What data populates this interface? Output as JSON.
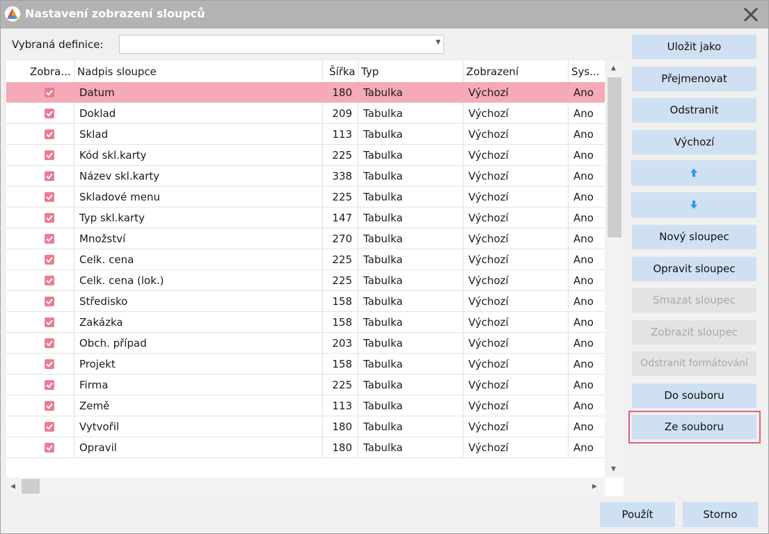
{
  "window": {
    "title": "Nastavení zobrazení sloupců"
  },
  "definition": {
    "label": "Vybraná definice:",
    "value": ""
  },
  "grid": {
    "headers": {
      "show": "Zobra...",
      "name": "Nadpis sloupce",
      "width": "Šířka",
      "type": "Typ",
      "display": "Zobrazení",
      "system": "Sys..."
    },
    "rows": [
      {
        "name": "Datum",
        "width": "180",
        "type": "Tabulka",
        "display": "Výchozí",
        "system": "Ano",
        "checked": true,
        "selected": true
      },
      {
        "name": "Doklad",
        "width": "209",
        "type": "Tabulka",
        "display": "Výchozí",
        "system": "Ano",
        "checked": true
      },
      {
        "name": "Sklad",
        "width": "113",
        "type": "Tabulka",
        "display": "Výchozí",
        "system": "Ano",
        "checked": true
      },
      {
        "name": "Kód skl.karty",
        "width": "225",
        "type": "Tabulka",
        "display": "Výchozí",
        "system": "Ano",
        "checked": true
      },
      {
        "name": "Název skl.karty",
        "width": "338",
        "type": "Tabulka",
        "display": "Výchozí",
        "system": "Ano",
        "checked": true
      },
      {
        "name": "Skladové menu",
        "width": "225",
        "type": "Tabulka",
        "display": "Výchozí",
        "system": "Ano",
        "checked": true
      },
      {
        "name": "Typ skl.karty",
        "width": "147",
        "type": "Tabulka",
        "display": "Výchozí",
        "system": "Ano",
        "checked": true
      },
      {
        "name": "Množství",
        "width": "270",
        "type": "Tabulka",
        "display": "Výchozí",
        "system": "Ano",
        "checked": true
      },
      {
        "name": "Celk. cena",
        "width": "225",
        "type": "Tabulka",
        "display": "Výchozí",
        "system": "Ano",
        "checked": true
      },
      {
        "name": "Celk. cena (lok.)",
        "width": "225",
        "type": "Tabulka",
        "display": "Výchozí",
        "system": "Ano",
        "checked": true
      },
      {
        "name": "Středisko",
        "width": "158",
        "type": "Tabulka",
        "display": "Výchozí",
        "system": "Ano",
        "checked": true
      },
      {
        "name": "Zakázka",
        "width": "158",
        "type": "Tabulka",
        "display": "Výchozí",
        "system": "Ano",
        "checked": true
      },
      {
        "name": "Obch. případ",
        "width": "203",
        "type": "Tabulka",
        "display": "Výchozí",
        "system": "Ano",
        "checked": true
      },
      {
        "name": "Projekt",
        "width": "158",
        "type": "Tabulka",
        "display": "Výchozí",
        "system": "Ano",
        "checked": true
      },
      {
        "name": "Firma",
        "width": "225",
        "type": "Tabulka",
        "display": "Výchozí",
        "system": "Ano",
        "checked": true
      },
      {
        "name": "Země",
        "width": "113",
        "type": "Tabulka",
        "display": "Výchozí",
        "system": "Ano",
        "checked": true
      },
      {
        "name": "Vytvořil",
        "width": "180",
        "type": "Tabulka",
        "display": "Výchozí",
        "system": "Ano",
        "checked": true
      },
      {
        "name": "Opravil",
        "width": "180",
        "type": "Tabulka",
        "display": "Výchozí",
        "system": "Ano",
        "checked": true
      }
    ]
  },
  "side_buttons": {
    "save_as": "Uložit jako",
    "rename": "Přejmenovat",
    "delete": "Odstranit",
    "default": "Výchozí",
    "move_up_icon": "arrow-up-icon",
    "move_down_icon": "arrow-down-icon",
    "new_column": "Nový sloupec",
    "edit_column": "Opravit sloupec",
    "delete_column": "Smazat sloupec",
    "show_column": "Zobrazit sloupec",
    "remove_formatting": "Odstranit formátování",
    "to_file": "Do souboru",
    "from_file": "Ze souboru"
  },
  "footer": {
    "apply": "Použít",
    "cancel": "Storno"
  },
  "colors": {
    "selected_row": "#f6a9b6",
    "checkbox": "#ea7d90",
    "button": "#cfe0f3",
    "focus": "#e0607a",
    "arrow": "#2e9be0"
  }
}
